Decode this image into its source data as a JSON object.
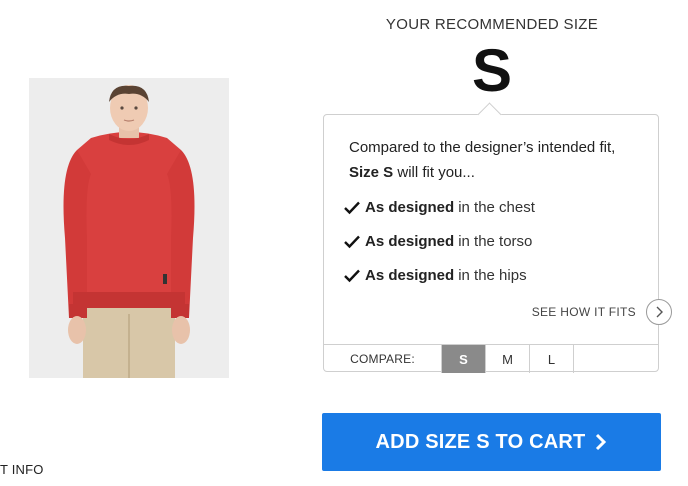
{
  "recommendation": {
    "label": "YOUR RECOMMENDED SIZE",
    "size": "S"
  },
  "fit_card": {
    "intro_line1": "Compared to the designer’s intended fit,",
    "intro_size": "Size S",
    "intro_rest": "will fit you...",
    "items": [
      {
        "strong": "As designed",
        "text": "in the chest"
      },
      {
        "strong": "As designed",
        "text": "in the torso"
      },
      {
        "strong": "As designed",
        "text": "in the hips"
      }
    ],
    "see_how_label": "SEE HOW IT FITS",
    "compare_label": "COMPARE:",
    "compare_options": [
      "S",
      "M",
      "L"
    ],
    "compare_selected": "S"
  },
  "cart": {
    "label": "ADD SIZE S TO CART"
  },
  "bottom_left_text": "T INFO",
  "colors": {
    "accent": "#1a7be6",
    "selected_option": "#8a8a8a",
    "sweater": "#d9403f"
  },
  "icons": [
    "checkmark-icon",
    "chevron-right-icon"
  ]
}
